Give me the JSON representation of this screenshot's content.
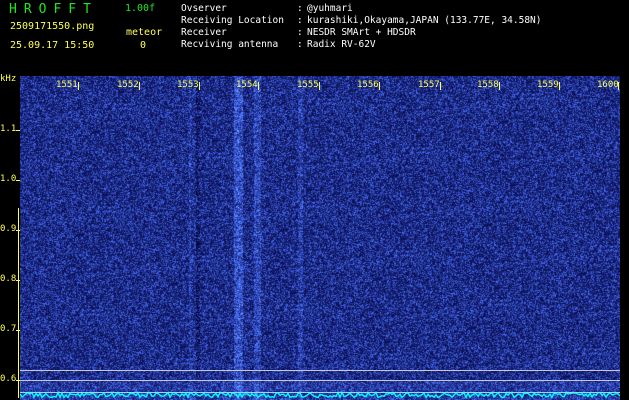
{
  "header": {
    "app_name": "HROFFT",
    "version": "1.00f",
    "filename": "2509171550.png",
    "mode": "meteor",
    "datetime": "25.09.17 15:50",
    "count": "0",
    "info": [
      {
        "label": "Ovserver",
        "value": "@yuhmari"
      },
      {
        "label": "Receiving Location",
        "value": "kurashiki,Okayama,JAPAN (133.77E, 34.58N)"
      },
      {
        "label": "Receiver",
        "value": "NESDR SMArt + HDSDR"
      },
      {
        "label": "Recviving antenna",
        "value": "Radix RV-62V"
      }
    ],
    "separator": ":"
  },
  "axes": {
    "y_unit": "kHz",
    "y_ticks": [
      "1.1",
      "1.0",
      "0.9",
      "0.8",
      "0.7",
      "0.6"
    ],
    "x_ticks": [
      "1551",
      "1552",
      "1553",
      "1554",
      "1555",
      "1556",
      "1557",
      "1558",
      "1559",
      "1600"
    ]
  },
  "colors": {
    "background": "#000000",
    "spectrum_base": "#000e55",
    "title_green": "#1fe61f",
    "label_yellow": "#ffff55",
    "baseline_cyan": "#00ffff"
  }
}
